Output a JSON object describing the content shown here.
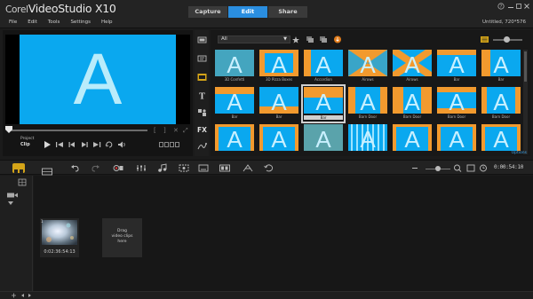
{
  "app": {
    "logo_corel": "Corel",
    "logo_name": "VideoStudio X10",
    "project_info": "Untitled, 720*576"
  },
  "mode_tabs": [
    {
      "label": "Capture",
      "active": false
    },
    {
      "label": "Edit",
      "active": true
    },
    {
      "label": "Share",
      "active": false
    }
  ],
  "menu": [
    "File",
    "Edit",
    "Tools",
    "Settings",
    "Help"
  ],
  "player": {
    "preview_letter": "A",
    "mode_project": "Project",
    "mode_clip": "Clip"
  },
  "library": {
    "filter_value": "All",
    "options_label": "Options",
    "thumbs": [
      {
        "label": "3D Confetti",
        "style": "confetti"
      },
      {
        "label": "3D Pizza Boxes",
        "style": "pizza"
      },
      {
        "label": "Accordion",
        "style": "accordion"
      },
      {
        "label": "Airows",
        "style": "arrows"
      },
      {
        "label": "Airows",
        "style": "arrows2"
      },
      {
        "label": "Bar",
        "style": "bar"
      },
      {
        "label": "Bar",
        "style": "bar2"
      },
      {
        "label": "Bar",
        "style": "bar3"
      },
      {
        "label": "Bar",
        "style": "bar4"
      },
      {
        "label": "Bar",
        "style": "barsel"
      },
      {
        "label": "Barn Door",
        "style": "barn"
      },
      {
        "label": "Barn Door",
        "style": "barn2"
      },
      {
        "label": "Barn Door",
        "style": "barn3"
      },
      {
        "label": "Barn Door",
        "style": "barn4"
      },
      {
        "label": "",
        "style": "row3a"
      },
      {
        "label": "",
        "style": "row3b"
      },
      {
        "label": "",
        "style": "row3c"
      },
      {
        "label": "",
        "style": "row3d"
      },
      {
        "label": "",
        "style": "row3e"
      },
      {
        "label": "",
        "style": "row3f"
      },
      {
        "label": "",
        "style": "row3g"
      }
    ],
    "selected_index": 9
  },
  "timeline": {
    "timecode": "0:00:54:10",
    "clip_number": "1",
    "clip_time": "0:02:36:54:13",
    "drag_text": [
      "Drag",
      "video clips",
      "here"
    ]
  },
  "colors": {
    "accent_blue": "#2a8ee0",
    "preview_blue": "#0aa8ef",
    "thumb_orange": "#f29a2e",
    "selected_tool": "#d4a418"
  }
}
